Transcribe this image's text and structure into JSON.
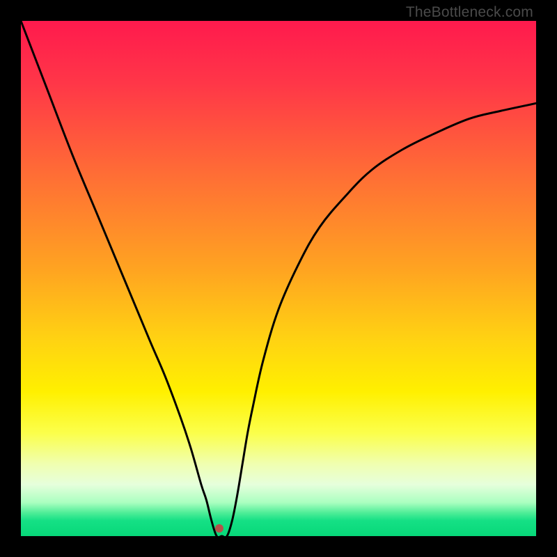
{
  "watermark": "TheBottleneck.com",
  "chart_data": {
    "type": "line",
    "title": "",
    "xlabel": "",
    "ylabel": "",
    "xlim": [
      0,
      100
    ],
    "ylim": [
      0,
      100
    ],
    "grid": false,
    "legend": false,
    "gradient_stops": [
      {
        "pos": 0.0,
        "color": "#ff1a4d"
      },
      {
        "pos": 0.12,
        "color": "#ff3648"
      },
      {
        "pos": 0.3,
        "color": "#ff6e35"
      },
      {
        "pos": 0.48,
        "color": "#ffa321"
      },
      {
        "pos": 0.62,
        "color": "#ffd312"
      },
      {
        "pos": 0.72,
        "color": "#fff000"
      },
      {
        "pos": 0.8,
        "color": "#fbff4b"
      },
      {
        "pos": 0.86,
        "color": "#f0ffb0"
      },
      {
        "pos": 0.9,
        "color": "#e6ffdc"
      },
      {
        "pos": 0.935,
        "color": "#aaffc0"
      },
      {
        "pos": 0.955,
        "color": "#4eed97"
      },
      {
        "pos": 0.97,
        "color": "#15e085"
      },
      {
        "pos": 1.0,
        "color": "#07d879"
      }
    ],
    "series": [
      {
        "name": "bottleneck-curve",
        "color": "#000000",
        "x": [
          0,
          5,
          10,
          15,
          20,
          25,
          28,
          31,
          33,
          35,
          36,
          37,
          38,
          39,
          40,
          41,
          42,
          43,
          44,
          45,
          47,
          50,
          54,
          58,
          63,
          68,
          74,
          80,
          87,
          93,
          100
        ],
        "values": [
          100,
          87,
          74,
          62,
          50,
          38,
          31,
          23,
          17,
          10,
          7,
          3,
          0,
          0,
          0,
          3,
          8,
          14,
          20,
          25,
          34,
          44,
          53,
          60,
          66,
          71,
          75,
          78,
          81,
          82.5,
          84
        ]
      }
    ],
    "marker": {
      "name": "min-point",
      "x": 38.5,
      "y": 1.5,
      "color": "#b5524a",
      "radius": 6
    }
  }
}
